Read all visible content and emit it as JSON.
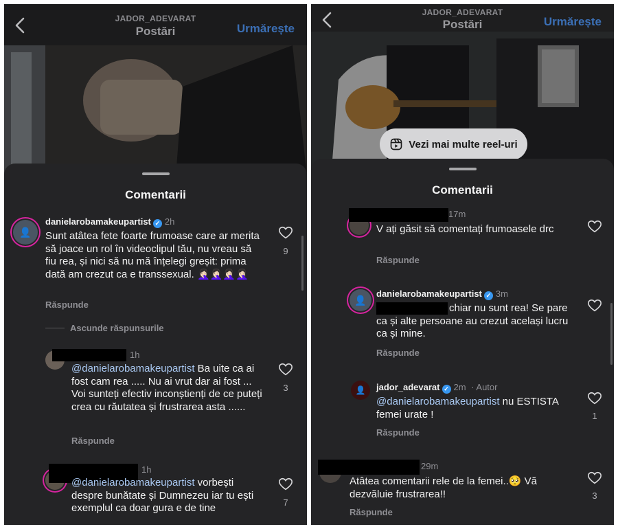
{
  "left": {
    "header": {
      "account": "JADOR_ADEVARAT",
      "title": "Postări",
      "follow": "Urmărește"
    },
    "sheet_title": "Comentarii",
    "comments": [
      {
        "username": "danielarobamakeupartist",
        "time": "2h",
        "text": "Sunt atâtea fete foarte frumoase care ar merita să joace un rol în videoclipul tău, nu vreau să fiu rea, și nici să nu mă înțelegi greșit: prima dată am crezut ca e transsexual. 🤦🏻‍♀️🤦🏻‍♀️🤦🏻‍♀️🤦🏻‍♀️",
        "reply": "Răspunde",
        "likes": "9"
      },
      {
        "time": "1h",
        "mention": "@danielarobamakeupartist",
        "text": " Ba uite ca ai fost cam rea ..... Nu ai vrut dar ai fost ... Voi sunteți efectiv inconștienți de ce puteți crea cu răutatea și frustrarea asta ......",
        "reply": "Răspunde",
        "likes": "3"
      },
      {
        "time": "1h",
        "mention": "@danielarobamakeupartist",
        "text": " vorbești despre bunătate și Dumnezeu iar tu ești exemplul ca doar gura e de tine",
        "likes": "7"
      }
    ],
    "hide_replies": "Ascunde răspunsurile"
  },
  "right": {
    "header": {
      "account": "JADOR_ADEVARAT",
      "title": "Postări",
      "follow": "Urmărește"
    },
    "reels_button": "Vezi mai multe reel-uri",
    "sheet_title": "Comentarii",
    "comments": [
      {
        "time": "17m",
        "text": "V ați găsit să comentați frumoasele drc",
        "reply": "Răspunde"
      },
      {
        "username": "danielarobamakeupartist",
        "time": "3m",
        "text": " chiar nu sunt rea! Se pare ca și alte persoane au crezut același lucru ca și mine.",
        "reply": "Răspunde"
      },
      {
        "username": "jador_adevarat",
        "time": "2m",
        "author_tag": "Autor",
        "mention": "@danielarobamakeupartist",
        "text": " nu ESTISTA femei urate !",
        "reply": "Răspunde",
        "likes": "1"
      },
      {
        "time": "29m",
        "text": "Atâtea comentarii rele de la femei..🥺 Vă dezvăluie frustrarea!!",
        "reply": "Răspunde",
        "likes": "3"
      }
    ]
  },
  "icons": {
    "back": "chevron-left-icon",
    "like": "heart-outline-icon",
    "verified": "verified-badge-icon",
    "reels": "reels-icon"
  },
  "colors": {
    "accent": "#3b6fb5",
    "verified": "#3897f0",
    "sheet": "#242426"
  }
}
